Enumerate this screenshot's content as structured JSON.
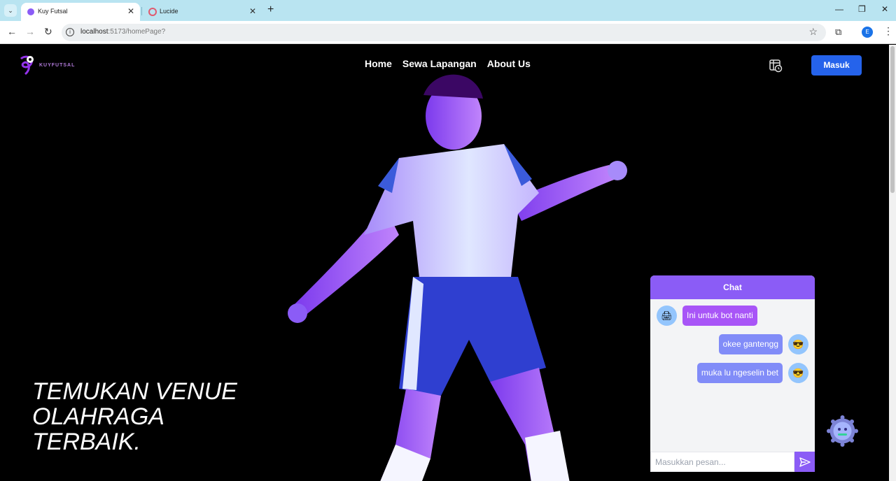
{
  "browser": {
    "tabs": [
      {
        "title": "Kuy Futsal",
        "active": true
      },
      {
        "title": "Lucide",
        "active": false
      }
    ],
    "url_host": "localhost",
    "url_path": ":5173/homePage?",
    "profile_initial": "E"
  },
  "header": {
    "logo_text": "KUYFUTSAL",
    "nav": [
      "Home",
      "Sewa Lapangan",
      "About Us"
    ],
    "login_label": "Masuk"
  },
  "hero": {
    "line1": "TEMUKAN VENUE",
    "line2": "OLAHRAGA",
    "line3": "TERBAIK."
  },
  "chat": {
    "title": "Chat",
    "messages": [
      {
        "from": "bot",
        "text": "Ini untuk bot nanti"
      },
      {
        "from": "user",
        "text": "okee gantengg"
      },
      {
        "from": "user",
        "text": "muka lu ngeselin bet"
      }
    ],
    "input_placeholder": "Masukkan pesan..."
  },
  "colors": {
    "accent": "#8b5cf6",
    "bot_bubble": "#a855f7",
    "user_bubble": "#818cf8",
    "login_button": "#2563eb"
  }
}
